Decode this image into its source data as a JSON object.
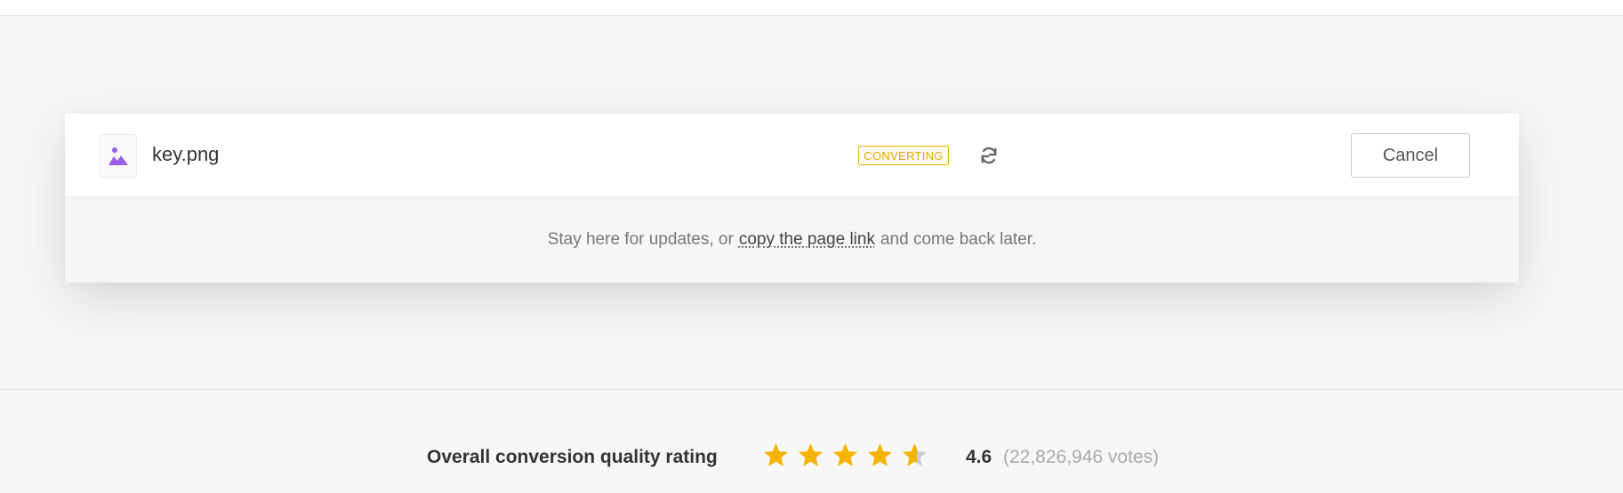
{
  "file": {
    "name": "key.png",
    "status": "CONVERTING",
    "thumb_icon": "image-icon",
    "refresh_icon": "refresh-icon",
    "cancel_label": "Cancel"
  },
  "info": {
    "before_link": "Stay here for updates, or",
    "link_text": "copy the page link",
    "after_link": "and come back later."
  },
  "rating": {
    "label": "Overall conversion quality rating",
    "score": "4.6",
    "votes": "(22,826,946 votes)",
    "stars_value": 4.6,
    "stars_max": 5,
    "star_color": "#f5b301",
    "star_empty_color": "#cccccc"
  },
  "colors": {
    "accent_purple": "#9b5de5",
    "status_yellow": "#e3a800"
  }
}
